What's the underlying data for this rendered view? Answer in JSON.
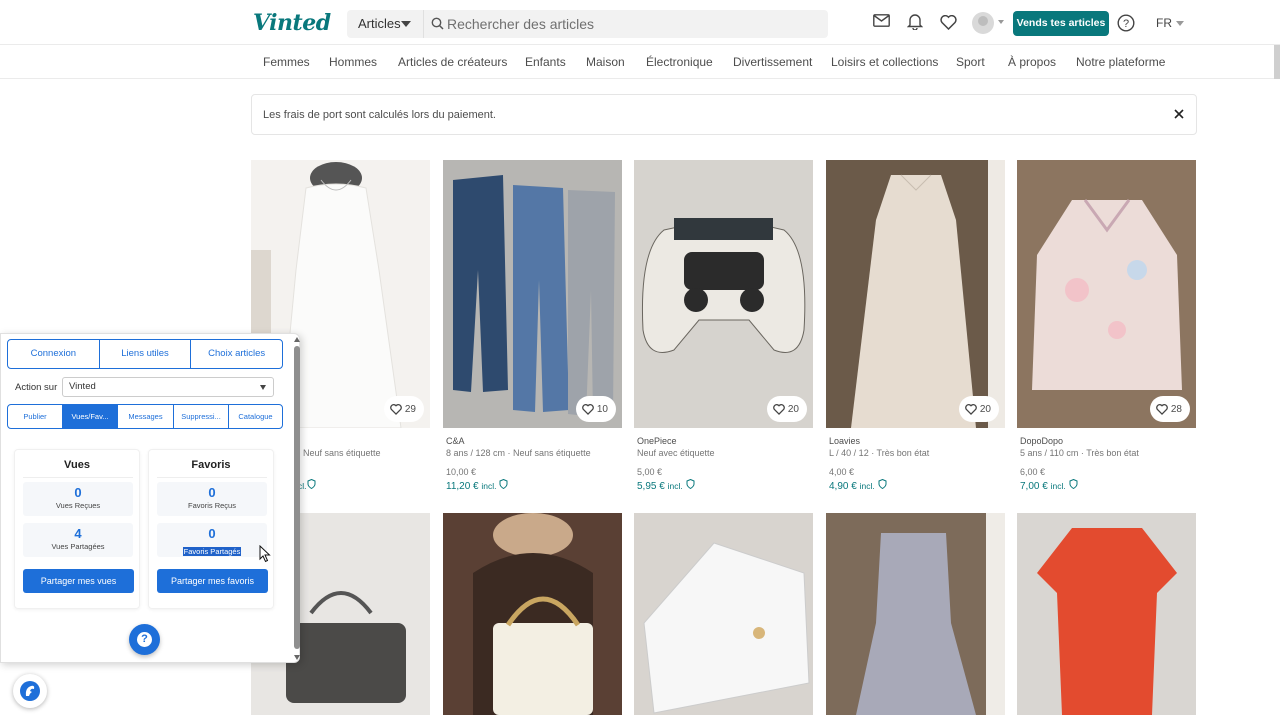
{
  "header": {
    "logo": "Vinted",
    "search_category": "Articles",
    "search_placeholder": "Rechercher des articles",
    "sell_button": "Vends tes articles",
    "language": "FR"
  },
  "nav": [
    "Femmes",
    "Hommes",
    "Articles de créateurs",
    "Enfants",
    "Maison",
    "Électronique",
    "Divertissement",
    "Loisirs et collections",
    "Sport",
    "À propos",
    "Notre plateforme"
  ],
  "banner": {
    "text": "Les frais de port sont calculés lors du paiement."
  },
  "items_row1": [
    {
      "brand": "",
      "meta": "Neuf sans étiquette",
      "price": "",
      "price_incl": "",
      "incl": "incl.",
      "favorites": "29"
    },
    {
      "brand": "C&A",
      "meta": "8 ans / 128 cm · Neuf sans étiquette",
      "price": "10,00 €",
      "price_incl": "11,20 €",
      "incl": "incl.",
      "favorites": "10"
    },
    {
      "brand": "OnePiece",
      "meta": "Neuf avec étiquette",
      "price": "5,00 €",
      "price_incl": "5,95 €",
      "incl": "incl.",
      "favorites": "20"
    },
    {
      "brand": "Loavies",
      "meta": "L / 40 / 12 · Très bon état",
      "price": "4,00 €",
      "price_incl": "4,90 €",
      "incl": "incl.",
      "favorites": "20"
    },
    {
      "brand": "DopoDopo",
      "meta": "5 ans / 110 cm · Très bon état",
      "price": "6,00 €",
      "price_incl": "7,00 €",
      "incl": "incl.",
      "favorites": "28"
    }
  ],
  "panel": {
    "top_tabs": [
      "Connexion",
      "Liens utiles",
      "Choix articles"
    ],
    "action_label": "Action sur",
    "action_value": "Vinted",
    "sub_tabs": [
      "Publier",
      "Vues/Fav...",
      "Messages",
      "Suppressi...",
      "Catalogue"
    ],
    "views": {
      "title": "Vues",
      "received_value": "0",
      "received_label": "Vues Reçues",
      "shared_value": "4",
      "shared_label": "Vues Partagées",
      "button": "Partager mes vues"
    },
    "favorites": {
      "title": "Favoris",
      "received_value": "0",
      "received_label": "Favoris Reçus",
      "shared_value": "0",
      "shared_label": "Favoris Partagés",
      "button": "Partager mes favoris"
    },
    "help": "?"
  },
  "colors": {
    "brand": "#09787c",
    "extension_accent": "#1e6fd9"
  },
  "icons": [
    "search-icon",
    "mail-icon",
    "bell-icon",
    "heart-icon",
    "help-icon",
    "close-icon",
    "shield-check-icon"
  ]
}
